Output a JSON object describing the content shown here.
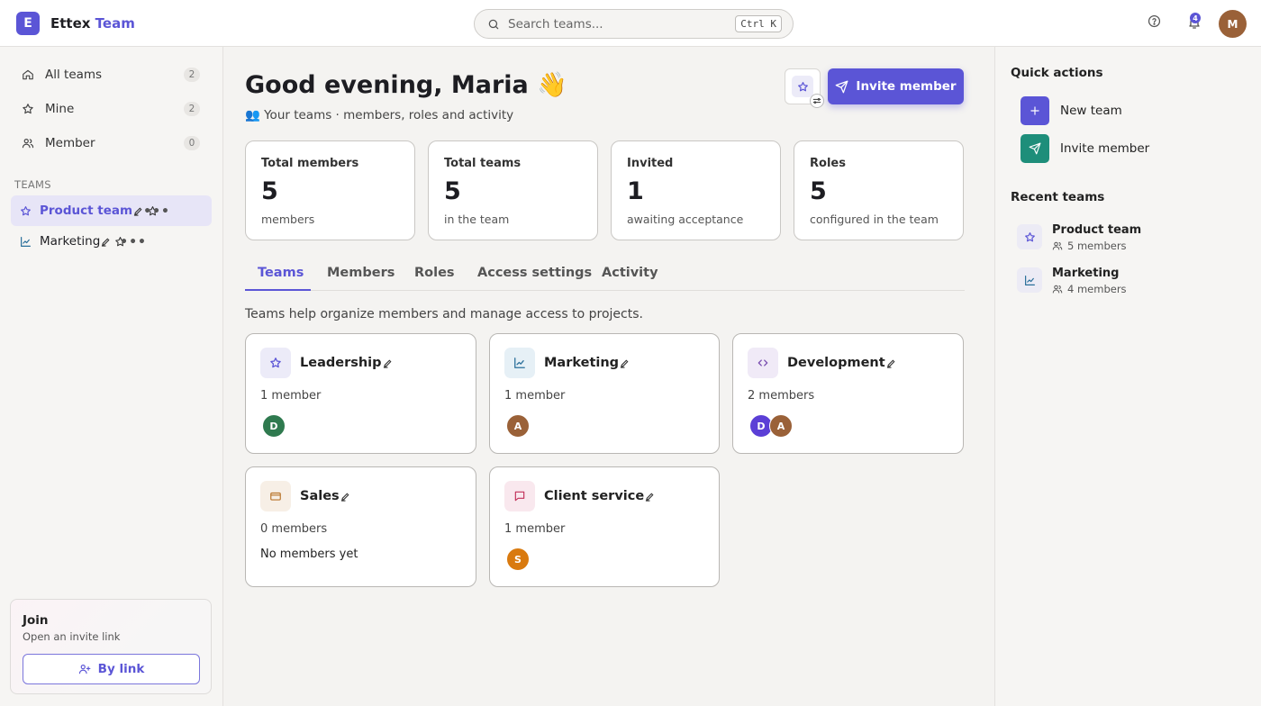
{
  "brand": {
    "logo_letter": "E",
    "name": "Ettex",
    "accent": "Team",
    "accent_color": "#5b55d6"
  },
  "search": {
    "placeholder": "Search teams...",
    "shortcut": "Ctrl K"
  },
  "header": {
    "notification_count": "4",
    "user_initial": "M"
  },
  "sidebar": {
    "nav": [
      {
        "label": "All teams",
        "count": "2",
        "icon": "home-icon"
      },
      {
        "label": "Mine",
        "count": "2",
        "icon": "star-icon"
      },
      {
        "label": "Member",
        "count": "0",
        "icon": "users-icon"
      }
    ],
    "section_label": "TEAMS",
    "teams": [
      {
        "label": "Product team",
        "icon": "star-icon",
        "active": true
      },
      {
        "label": "Marketing",
        "icon": "chart-icon",
        "active": false
      }
    ],
    "join": {
      "title": "Join",
      "subtitle": "Open an invite link",
      "button": "By link"
    }
  },
  "main": {
    "greeting": "Good evening, Maria 👋",
    "subline": "👥 Your teams · members, roles and activity",
    "invite_button": "Invite member",
    "stats": [
      {
        "title": "Total members",
        "value": "5",
        "sub": "members"
      },
      {
        "title": "Total teams",
        "value": "5",
        "sub": "in the team"
      },
      {
        "title": "Invited",
        "value": "1",
        "sub": "awaiting acceptance"
      },
      {
        "title": "Roles",
        "value": "5",
        "sub": "configured in the team"
      }
    ],
    "tabs": [
      "Teams",
      "Members",
      "Roles",
      "Access settings",
      "Activity"
    ],
    "active_tab": "Teams",
    "help_text": "Teams help organize members and manage access to projects.",
    "cards": [
      {
        "name": "Leadership",
        "count": "1 member",
        "icon": "star-icon",
        "avatars": [
          {
            "initial": "D",
            "color": "#2f7a4f"
          }
        ]
      },
      {
        "name": "Marketing",
        "count": "1 member",
        "icon": "chart-icon",
        "avatars": [
          {
            "initial": "A",
            "color": "#9a6138"
          }
        ]
      },
      {
        "name": "Development",
        "count": "2 members",
        "icon": "code-icon",
        "avatars": [
          {
            "initial": "D",
            "color": "#5b3fd6"
          },
          {
            "initial": "A",
            "color": "#9a6138"
          }
        ]
      },
      {
        "name": "Sales",
        "count": "0 members",
        "icon": "card-icon",
        "empty_text": "No members yet"
      },
      {
        "name": "Client service",
        "count": "1 member",
        "icon": "chat-icon",
        "avatars": [
          {
            "initial": "S",
            "color": "#d97a0f"
          }
        ]
      }
    ]
  },
  "right_panel": {
    "quick_actions_title": "Quick actions",
    "quick_actions": [
      {
        "label": "New team",
        "icon": "plus-icon",
        "color": "#5b55d6"
      },
      {
        "label": "Invite member",
        "icon": "send-icon",
        "color": "#1e8e7a"
      }
    ],
    "recent_title": "Recent teams",
    "recent": [
      {
        "name": "Product team",
        "members": "5 members",
        "icon": "star-icon"
      },
      {
        "name": "Marketing",
        "members": "4 members",
        "icon": "chart-icon"
      }
    ]
  }
}
